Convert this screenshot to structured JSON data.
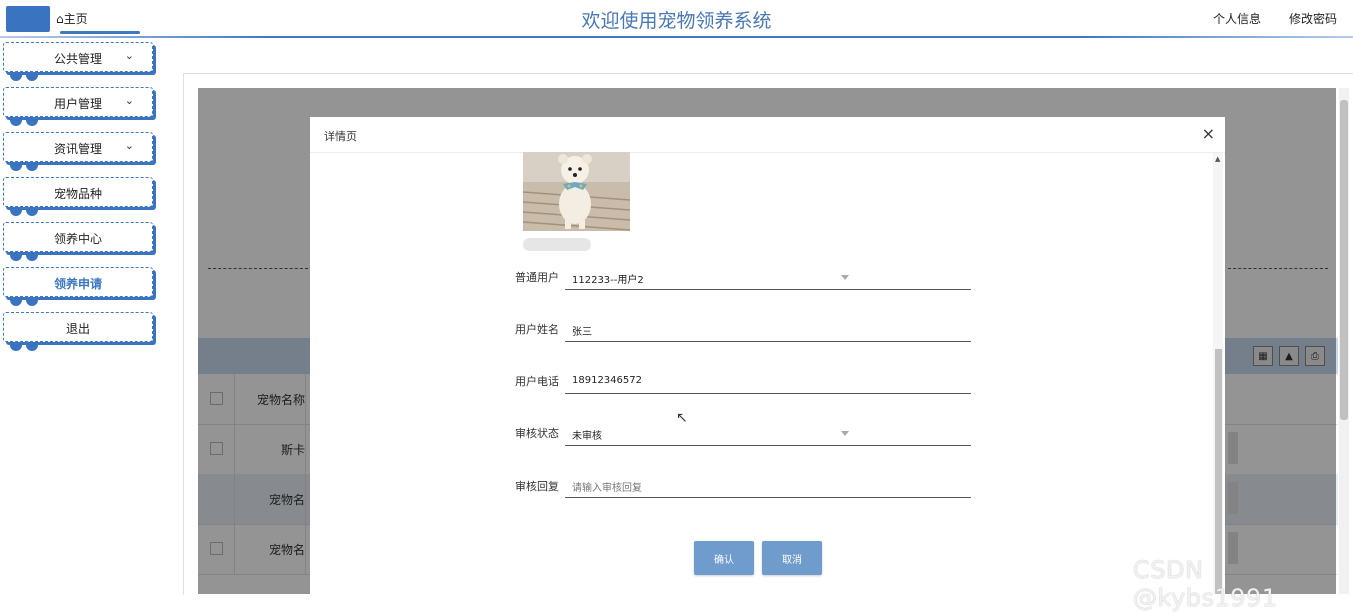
{
  "header": {
    "home": "⌂主页",
    "title": "欢迎使用宠物领养系统",
    "profile": "个人信息",
    "change_password": "修改密码"
  },
  "sidebar": {
    "items": [
      {
        "label": "公共管理",
        "has_chevron": true
      },
      {
        "label": "用户管理",
        "has_chevron": true
      },
      {
        "label": "资讯管理",
        "has_chevron": true
      },
      {
        "label": "宠物品种",
        "has_chevron": false
      },
      {
        "label": "领养中心",
        "has_chevron": false
      },
      {
        "label": "领养申请",
        "has_chevron": false,
        "active": true
      },
      {
        "label": "退出",
        "has_chevron": false
      }
    ]
  },
  "background_table": {
    "column_header": "宠物名称",
    "rows": [
      "斯卡",
      "宠物名",
      "宠物名"
    ]
  },
  "modal": {
    "title": "详情页",
    "close": "×",
    "fields": [
      {
        "label": "普通用户",
        "value": "112233--用户2",
        "type": "select"
      },
      {
        "label": "用户姓名",
        "value": "张三",
        "type": "input"
      },
      {
        "label": "用户电话",
        "value": "18912346572",
        "type": "input"
      },
      {
        "label": "审核状态",
        "value": "未审核",
        "type": "select"
      },
      {
        "label": "审核回复",
        "value": "",
        "placeholder": "请输入审核回复",
        "type": "input"
      }
    ],
    "confirm": "确认",
    "cancel": "取消"
  },
  "watermark": "CSDN @kybs1991",
  "colors": {
    "accent": "#3f78c2",
    "button": "#6f9ccc",
    "title": "#4a78b5"
  }
}
